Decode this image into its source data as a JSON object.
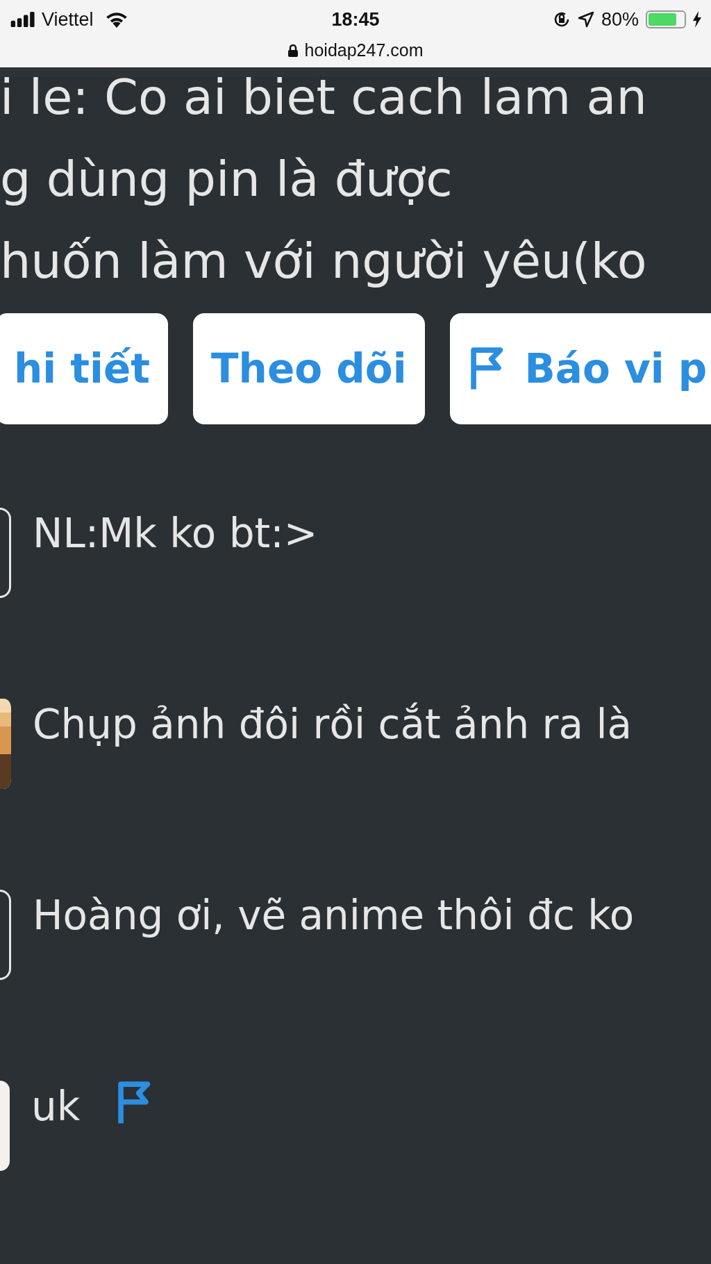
{
  "status_bar": {
    "carrier": "Viettel",
    "time": "18:45",
    "url": "hoidap247.com",
    "battery": "80%"
  },
  "question_lines": [
    "i le: Co ai biet cach lam an",
    "g dùng pin là được",
    "huốn làm với người yêu(ko"
  ],
  "actions": [
    {
      "label": "hi tiết",
      "kind": "text"
    },
    {
      "label": "Theo dõi",
      "kind": "text"
    },
    {
      "label": "Báo vi p",
      "kind": "flag"
    }
  ],
  "comments": [
    {
      "text": "NL:Mk ko bt:>",
      "kind": "outline",
      "flag": false
    },
    {
      "text": "Chụp ảnh đôi rồi cắt ảnh ra là",
      "kind": "picture",
      "flag": false
    },
    {
      "text": "Hoàng ơi, vẽ anime thôi đc ko",
      "kind": "outline",
      "flag": false
    },
    {
      "text": "uk",
      "kind": "light",
      "flag": true
    }
  ]
}
